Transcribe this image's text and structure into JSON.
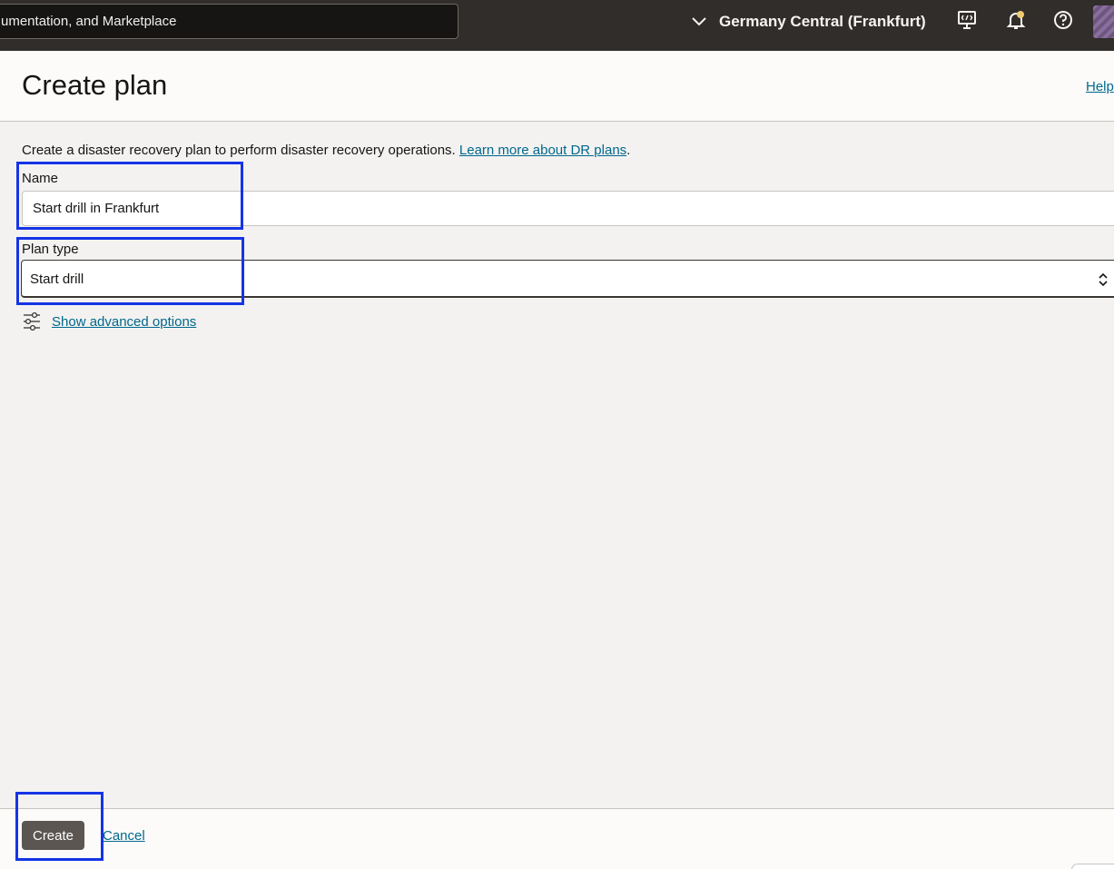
{
  "topbar": {
    "search_text": "umentation, and Marketplace",
    "region": "Germany Central (Frankfurt)",
    "icons": [
      "chevron-down-icon",
      "cloud-shell-icon",
      "notification-bell-icon",
      "help-circle-icon",
      "profile-avatar-icon"
    ]
  },
  "header": {
    "title": "Create plan",
    "help_link": "Help"
  },
  "form": {
    "description": "Create a disaster recovery plan to perform disaster recovery operations. ",
    "learn_more": "Learn more about DR plans",
    "description_end": ".",
    "name_label": "Name",
    "name_value": "Start drill in Frankfurt",
    "plan_type_label": "Plan type",
    "plan_type_value": "Start drill",
    "advanced_options": "Show advanced options"
  },
  "footer": {
    "create_label": "Create",
    "cancel_label": "Cancel"
  },
  "colors": {
    "topbar_bg": "#312d2a",
    "link": "#00688c",
    "primary_button": "#5b5652",
    "highlight": "#1534e6"
  }
}
